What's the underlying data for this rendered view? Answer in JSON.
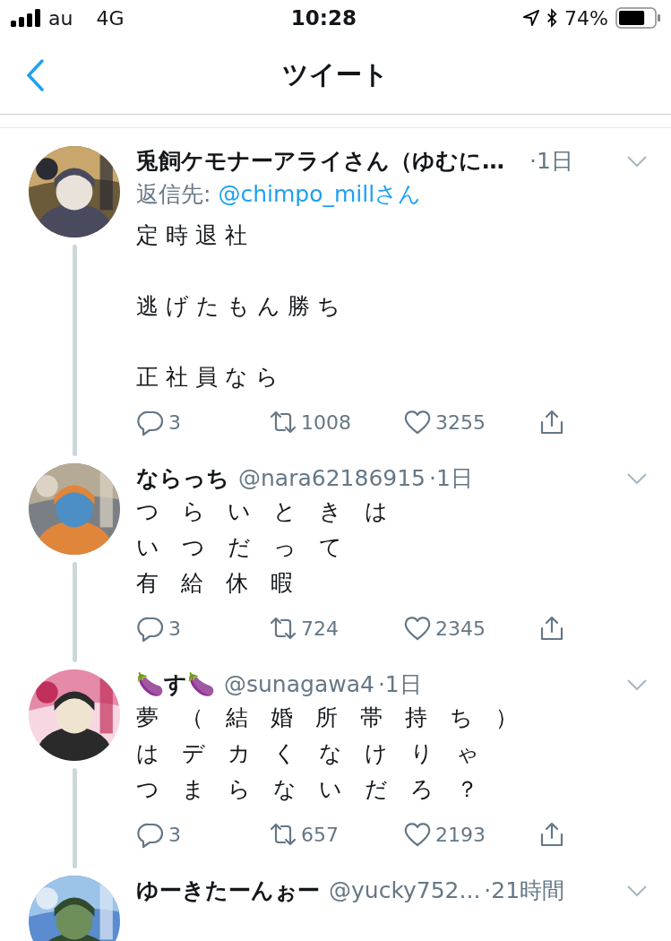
{
  "status_bar": {
    "carrier": "au",
    "network": "4G",
    "time": "10:28",
    "battery": "74%"
  },
  "nav": {
    "title": "ツイート"
  },
  "tweets": [
    {
      "name": "兎飼ケモナーアライさん（ゆむに…",
      "time": "·1日",
      "reply_label": "返信先:",
      "reply_to": "@chimpo_millさん",
      "paragraphs": [
        [
          "定 時 退 社"
        ],
        [
          "逃 げ た も ん 勝 ち"
        ],
        [
          "正 社 員 な ら"
        ]
      ],
      "replies": "3",
      "retweets": "1008",
      "likes": "3255"
    },
    {
      "name": "ならっち",
      "handle": "@nara62186915",
      "time": "·1日",
      "paragraphs": [
        [
          "つ　ら　い　と　き　は",
          "い　つ　だ　っ　て",
          "有　給　休　暇"
        ]
      ],
      "replies": "3",
      "retweets": "724",
      "likes": "2345"
    },
    {
      "name": "🍆す🍆",
      "handle": "@sunagawa4",
      "time": "·1日",
      "paragraphs": [
        [
          "夢　（　結　婚　所　帯　持　ち　）",
          "は　デ　カ　く　な　け　り　ゃ",
          "つ　ま　ら　な　い　だ　ろ　？"
        ]
      ],
      "replies": "3",
      "retweets": "657",
      "likes": "2193"
    },
    {
      "name": "ゆーきたーんぉー",
      "handle": "@yucky752...",
      "time": "·21時間"
    }
  ]
}
